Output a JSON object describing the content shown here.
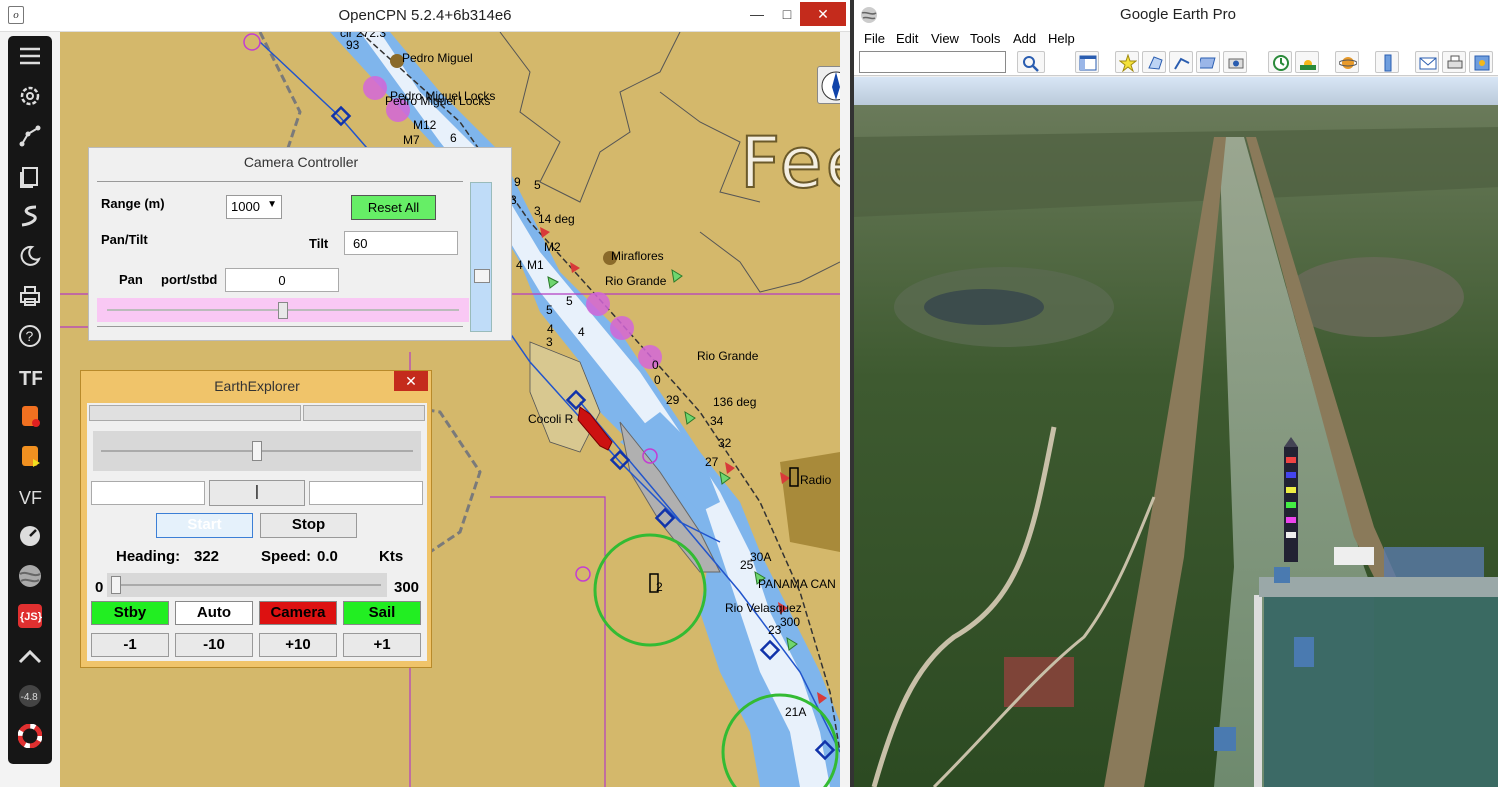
{
  "opencpn": {
    "title": "OpenCPN 5.2.4+6b314e6",
    "feet_label": "Feet",
    "toolbar_items": [
      "menu-icon",
      "settings-icon",
      "route-icon",
      "layers-icon",
      "tracks-icon",
      "moon-icon",
      "print-icon",
      "help-icon",
      "tide-icon",
      "record-icon",
      "playback-icon",
      "vf-icon",
      "dashboard-icon",
      "globe-icon",
      "javascript-icon",
      "chart-icon",
      "value-icon",
      "lifebuoy-icon"
    ],
    "toolbar_value": "-4.8",
    "toolbar_js": "{JS}",
    "chart_labels": [
      {
        "text": "Pedro Miguel"
      },
      {
        "text": "Pedro Miguel Locks"
      },
      {
        "text": "Pedro Miguel Locks"
      },
      {
        "text": "M12"
      },
      {
        "text": "M7"
      },
      {
        "text": "Miraflores"
      },
      {
        "text": "Rio Grande"
      },
      {
        "text": "Rio Grande"
      },
      {
        "text": "M2"
      },
      {
        "text": "M1"
      },
      {
        "text": "136 deg"
      },
      {
        "text": "14 deg"
      },
      {
        "text": "Cocoli R"
      },
      {
        "text": "Radio"
      },
      {
        "text": "PANAMA CAN"
      },
      {
        "text": "Rio Velasquez"
      },
      {
        "text": "30A"
      },
      {
        "text": "21A"
      },
      {
        "text": "300"
      },
      {
        "text": "cir 272.3"
      },
      {
        "text": "93"
      }
    ],
    "camera": {
      "title": "Camera Controller",
      "range_label": "Range (m)",
      "range_value": "1000",
      "reset_label": "Reset All",
      "pantilt_label": "Pan/Tilt",
      "tilt_label": "Tilt",
      "tilt_value": "60",
      "pan_label": "Pan",
      "portstbd_label": "port/stbd",
      "pan_value": "0",
      "pan_slider_fraction": 0.5
    },
    "earth_explorer": {
      "title": "EarthExplorer",
      "close": "✕",
      "center_button": "|",
      "start_label": "Start",
      "stop_label": "Stop",
      "heading_label": "Heading:",
      "heading_value": "322",
      "speed_label": "Speed:",
      "speed_value": "0.0",
      "speed_unit": "Kts",
      "slider_min": "0",
      "slider_max": "300",
      "slider_value": 0,
      "top_slider_fraction": 0.5,
      "mode_buttons": [
        {
          "label": "Stby",
          "color": "#22ee22"
        },
        {
          "label": "Auto",
          "color": "#ffffff"
        },
        {
          "label": "Camera",
          "color": "#dd1111"
        },
        {
          "label": "Sail",
          "color": "#22ee22"
        }
      ],
      "step_buttons": [
        "-1",
        "-10",
        "+10",
        "+1"
      ]
    }
  },
  "google_earth": {
    "title": "Google Earth Pro",
    "menu": [
      "File",
      "Edit",
      "View",
      "Tools",
      "Add",
      "Help"
    ],
    "search_placeholder": "",
    "toolbar_icons": [
      "search-icon",
      "sidebar-icon",
      "placemark-icon",
      "polygon-icon",
      "path-icon",
      "overlay-icon",
      "tour-icon",
      "historical-imagery-icon",
      "sunlight-icon",
      "planets-icon",
      "ruler-icon",
      "email-icon",
      "print-icon",
      "save-image-icon"
    ]
  },
  "colors": {
    "land": "#d4b86b",
    "water_shallow": "#7fb5ec",
    "water_deep": "#e8f1fb",
    "camera_slider": "#f9c8f4",
    "green_button": "#22ee22",
    "red_button": "#dd1111"
  }
}
